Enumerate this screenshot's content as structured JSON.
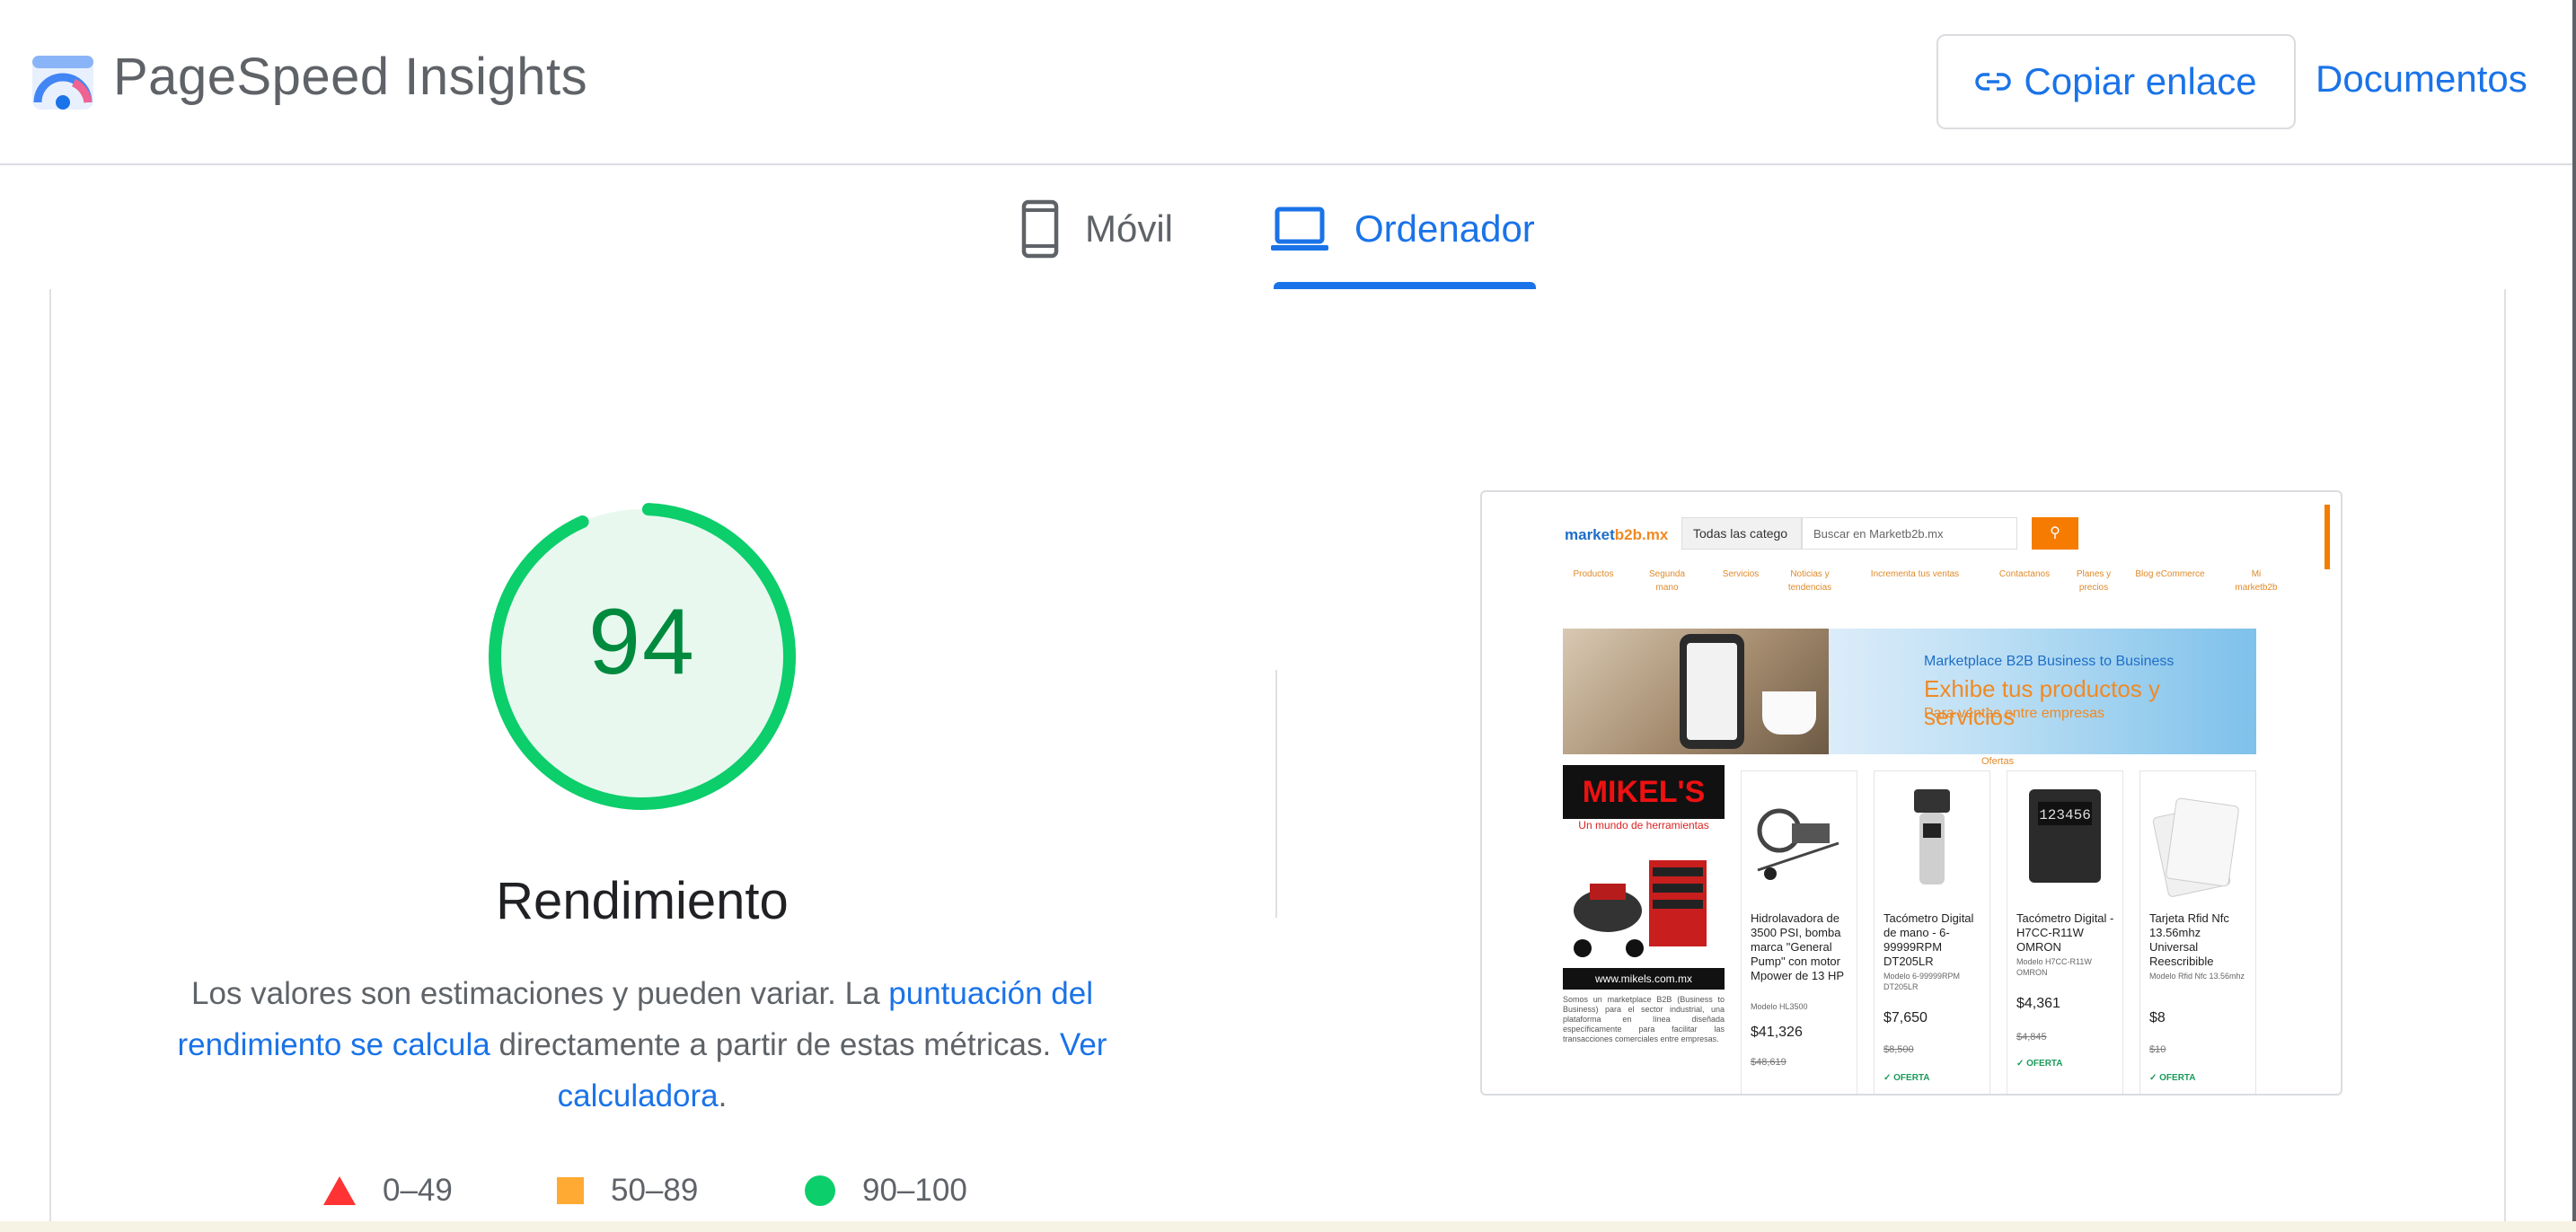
{
  "header": {
    "title": "PageSpeed Insights",
    "copy_link_label": "Copiar enlace",
    "docs_label": "Documentos"
  },
  "tabs": [
    {
      "label": "Móvil",
      "active": false
    },
    {
      "label": "Ordenador",
      "active": true
    }
  ],
  "colors": {
    "accent": "#1a73e8",
    "pass": "#0cce6b",
    "pass_text": "#008a3e",
    "average": "#ffaa33",
    "fail": "#ff3333"
  },
  "performance": {
    "score": "94",
    "score_fraction": 0.94,
    "title": "Rendimiento",
    "desc_1": "Los valores son estimaciones y pueden variar. La ",
    "link_1": "puntuación del rendimiento se calcula",
    "desc_2": " directamente a partir de estas métricas. ",
    "link_2": "Ver calculadora",
    "desc_3": "."
  },
  "legend": [
    {
      "range": "0–49",
      "shape": "triangle"
    },
    {
      "range": "50–89",
      "shape": "square"
    },
    {
      "range": "90–100",
      "shape": "circle"
    }
  ],
  "screenshot": {
    "logo_main": "market",
    "logo_accent": "b2b.mx",
    "category_select": "Todas las catego",
    "search_placeholder": "Buscar en Marketb2b.mx",
    "nav": [
      "Productos",
      "Segunda mano",
      "Servicios",
      "Noticias y tendencias",
      "Incrementa tus ventas",
      "Contactanos",
      "Planes y precios",
      "Blog eCommerce",
      "Mi marketb2b"
    ],
    "banner_line1": "Marketplace B2B Business to Business",
    "banner_line2": "Exhibe tus productos y servicios",
    "banner_line3": "Para ventas entre empresas",
    "ofertas": "Ofertas",
    "mikels_brand": "MIKEL'S",
    "mikels_tagline": "Un mundo de herramientas",
    "mikels_url": "www.mikels.com.mx",
    "mikels_text": "Somos un marketplace B2B (Business to Business) para el sector industrial, una plataforma en línea diseñada específicamente para facilitar las transacciones comerciales entre empresas.",
    "products": [
      {
        "name": "Hidrolavadora de 3500 PSI, bomba marca \"General Pump\" con motor Mpower de 13 HP",
        "model": "Modelo HL3500",
        "price": "$41,326",
        "old_price": "$48,619",
        "tag": ""
      },
      {
        "name": "Tacómetro Digital de mano - 6-99999RPM DT205LR",
        "model": "Modelo 6-99999RPM DT205LR",
        "price": "$7,650",
        "old_price": "$8,500",
        "tag": "✓ OFERTA"
      },
      {
        "name": "Tacómetro Digital - H7CC-R11W OMRON",
        "model": "Modelo H7CC-R11W OMRON",
        "price": "$4,361",
        "old_price": "$4,845",
        "tag": "✓ OFERTA"
      },
      {
        "name": "Tarjeta Rfid Nfc 13.56mhz Universal Reescribible",
        "model": "Modelo Rfid Nfc 13.56mhz",
        "price": "$8",
        "old_price": "$10",
        "tag": "✓ OFERTA"
      }
    ]
  }
}
